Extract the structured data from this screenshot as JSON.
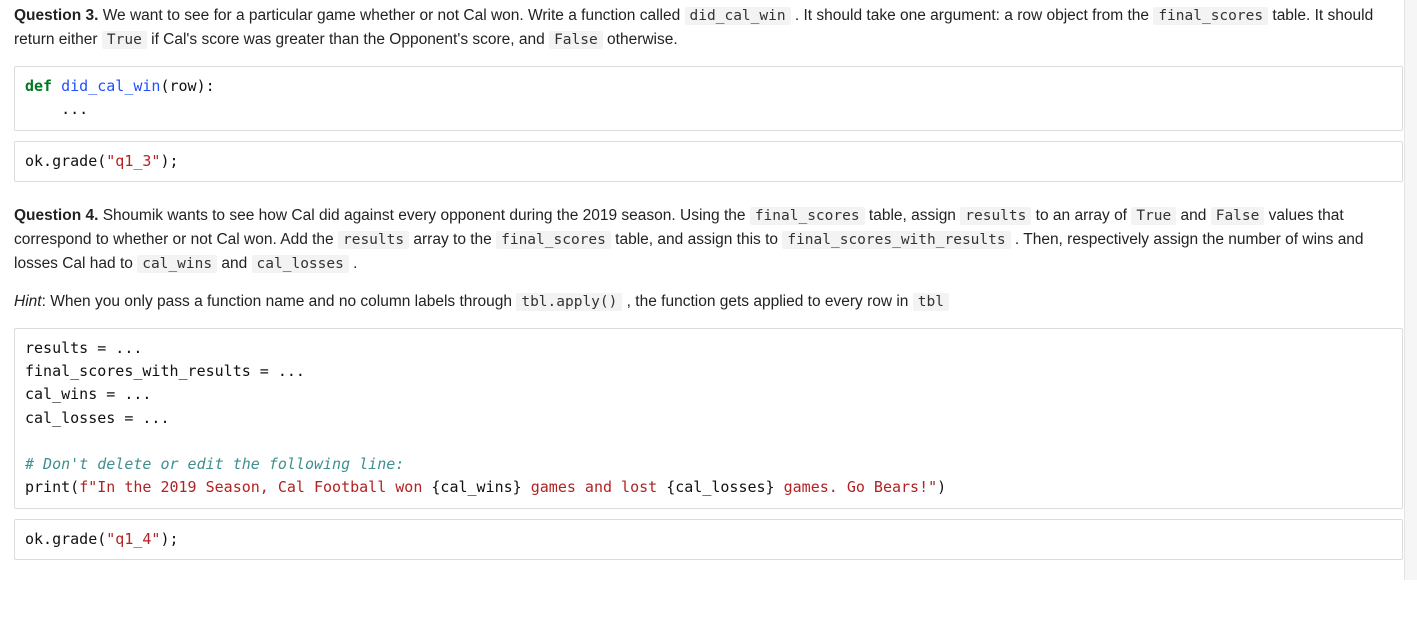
{
  "q3": {
    "label": "Question 3.",
    "text_a": " We want to see for a particular game whether or not Cal won. Write a function called ",
    "code_fn": "did_cal_win",
    "text_b": " . It should take one argument: a row object from the ",
    "code_table": "final_scores",
    "text_c": " table. It should return either ",
    "code_true": "True",
    "text_d": " if Cal's score was greater than the Opponent's score, and ",
    "code_false": "False",
    "text_e": " otherwise."
  },
  "cell1": {
    "kw_def": "def",
    "space1": " ",
    "fn_name": "did_cal_win",
    "sig_rest": "(row):",
    "line2": "    ..."
  },
  "cell2": {
    "prefix": "ok.grade(",
    "str": "\"q1_3\"",
    "suffix": ");"
  },
  "q4": {
    "label": "Question 4.",
    "t1": " Shoumik wants to see how Cal did against every opponent during the 2019 season. Using the ",
    "c1": "final_scores",
    "t2": " table, assign ",
    "c2": "results",
    "t3": " to an array of ",
    "c3": "True",
    "t4": " and ",
    "c4": "False",
    "t5": " values that correspond to whether or not Cal won. Add the ",
    "c5": "results",
    "t6": " array to the ",
    "c6": "final_scores",
    "t7": " table, and assign this to ",
    "c7": "final_scores_with_results",
    "t8": " . Then, respectively assign the number of wins and losses Cal had to ",
    "c8": "cal_wins",
    "t9": " and ",
    "c9": "cal_losses",
    "t10": " ."
  },
  "hint": {
    "label": "Hint",
    "t1": ": When you only pass a function name and no column labels through ",
    "c1": "tbl.apply()",
    "t2": " , the function gets applied to every row in ",
    "c2": "tbl"
  },
  "cell3": {
    "l1": "results = ...",
    "l2": "final_scores_with_results = ...",
    "l3": "cal_wins = ...",
    "l4": "cal_losses = ...",
    "blank": "",
    "comment": "# Don't delete or edit the following line:",
    "p_prefix": "print(",
    "fstr_a": "f\"In the 2019 Season, Cal Football won ",
    "expr1": "{cal_wins}",
    "fstr_b": " games and lost ",
    "expr2": "{cal_losses}",
    "fstr_c": " games. Go Bears!\"",
    "p_suffix": ")"
  },
  "cell4": {
    "prefix": "ok.grade(",
    "str": "\"q1_4\"",
    "suffix": ");"
  }
}
